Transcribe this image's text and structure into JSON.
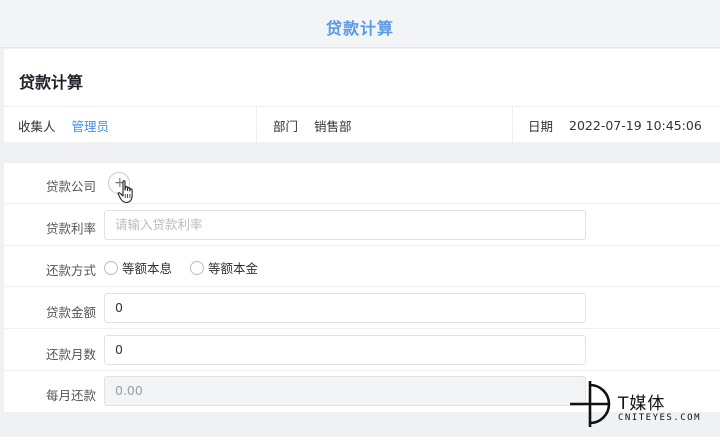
{
  "header": {
    "title": "贷款计算"
  },
  "form_header": {
    "title": "贷款计算",
    "collector_label": "收集人",
    "collector_value": "管理员",
    "department_label": "部门",
    "department_value": "销售部",
    "date_label": "日期",
    "date_value": "2022-07-19 10:45:06"
  },
  "form": {
    "company_label": "贷款公司",
    "rate_label": "贷款利率",
    "rate_placeholder": "请输入贷款利率",
    "repay_method_label": "还款方式",
    "repay_options": [
      "等额本息",
      "等额本金"
    ],
    "amount_label": "贷款金额",
    "amount_value": "0",
    "months_label": "还款月数",
    "months_value": "0",
    "monthly_label": "每月还款",
    "monthly_value": "0.00"
  },
  "icons": {
    "add": "plus-circle-icon",
    "cursor": "hand-pointer-icon"
  },
  "watermark": {
    "cn": "T媒体",
    "en": "CNITEYES.COM"
  },
  "colors": {
    "accent": "#4a90e2",
    "title": "#5b9be6"
  }
}
